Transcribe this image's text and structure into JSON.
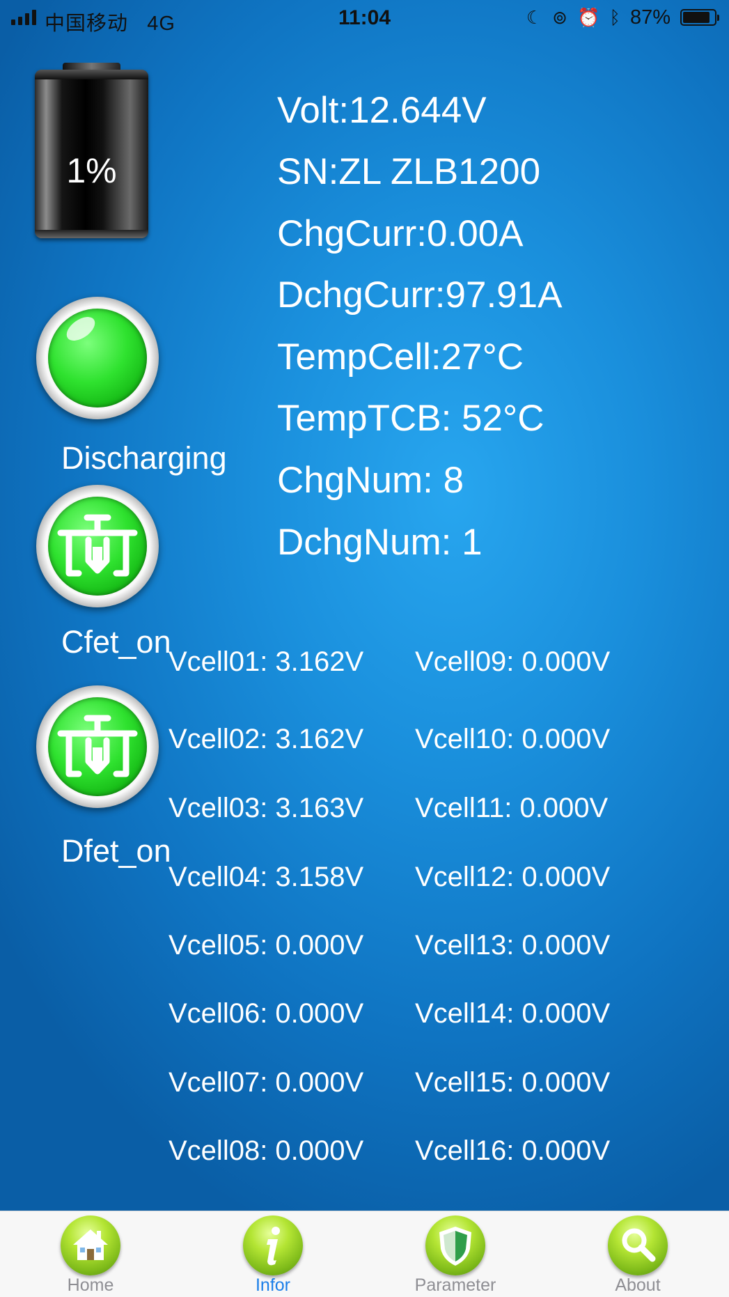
{
  "status_bar": {
    "carrier": "中国移动",
    "network": "4G",
    "time": "11:04",
    "battery_percent": "87%"
  },
  "battery_widget": {
    "percent": "1%"
  },
  "indicators": {
    "state_label": "Discharging",
    "cfet_label": "Cfet_on",
    "dfet_label": "Dfet_on"
  },
  "info": {
    "volt": "Volt:12.644V",
    "sn": "SN:ZL ZLB1200",
    "chg_curr": "ChgCurr:0.00A",
    "dchg_curr": "DchgCurr:97.91A",
    "temp_cell": "TempCell:27°C",
    "temp_tcb": "TempTCB: 52°C",
    "chg_num": "ChgNum: 8",
    "dchg_num": "DchgNum: 1"
  },
  "cells_left": [
    "Vcell01: 3.162V",
    "Vcell02: 3.162V",
    "Vcell03: 3.163V",
    "Vcell04: 3.158V",
    "Vcell05: 0.000V",
    "Vcell06: 0.000V",
    "Vcell07: 0.000V",
    "Vcell08: 0.000V"
  ],
  "cells_right": [
    "Vcell09: 0.000V",
    "Vcell10: 0.000V",
    "Vcell11: 0.000V",
    "Vcell12: 0.000V",
    "Vcell13: 0.000V",
    "Vcell14: 0.000V",
    "Vcell15: 0.000V",
    "Vcell16: 0.000V"
  ],
  "tabs": [
    {
      "label": "Home",
      "icon": "home-icon"
    },
    {
      "label": "Infor",
      "icon": "info-icon"
    },
    {
      "label": "Parameter",
      "icon": "shield-icon"
    },
    {
      "label": "About",
      "icon": "magnifier-icon"
    }
  ],
  "active_tab": "Infor",
  "colors": {
    "background": "#1a8fdc",
    "led_green": "#2fe22f",
    "active_tab": "#1a7ee8",
    "inactive_tab": "#8e8e93"
  }
}
